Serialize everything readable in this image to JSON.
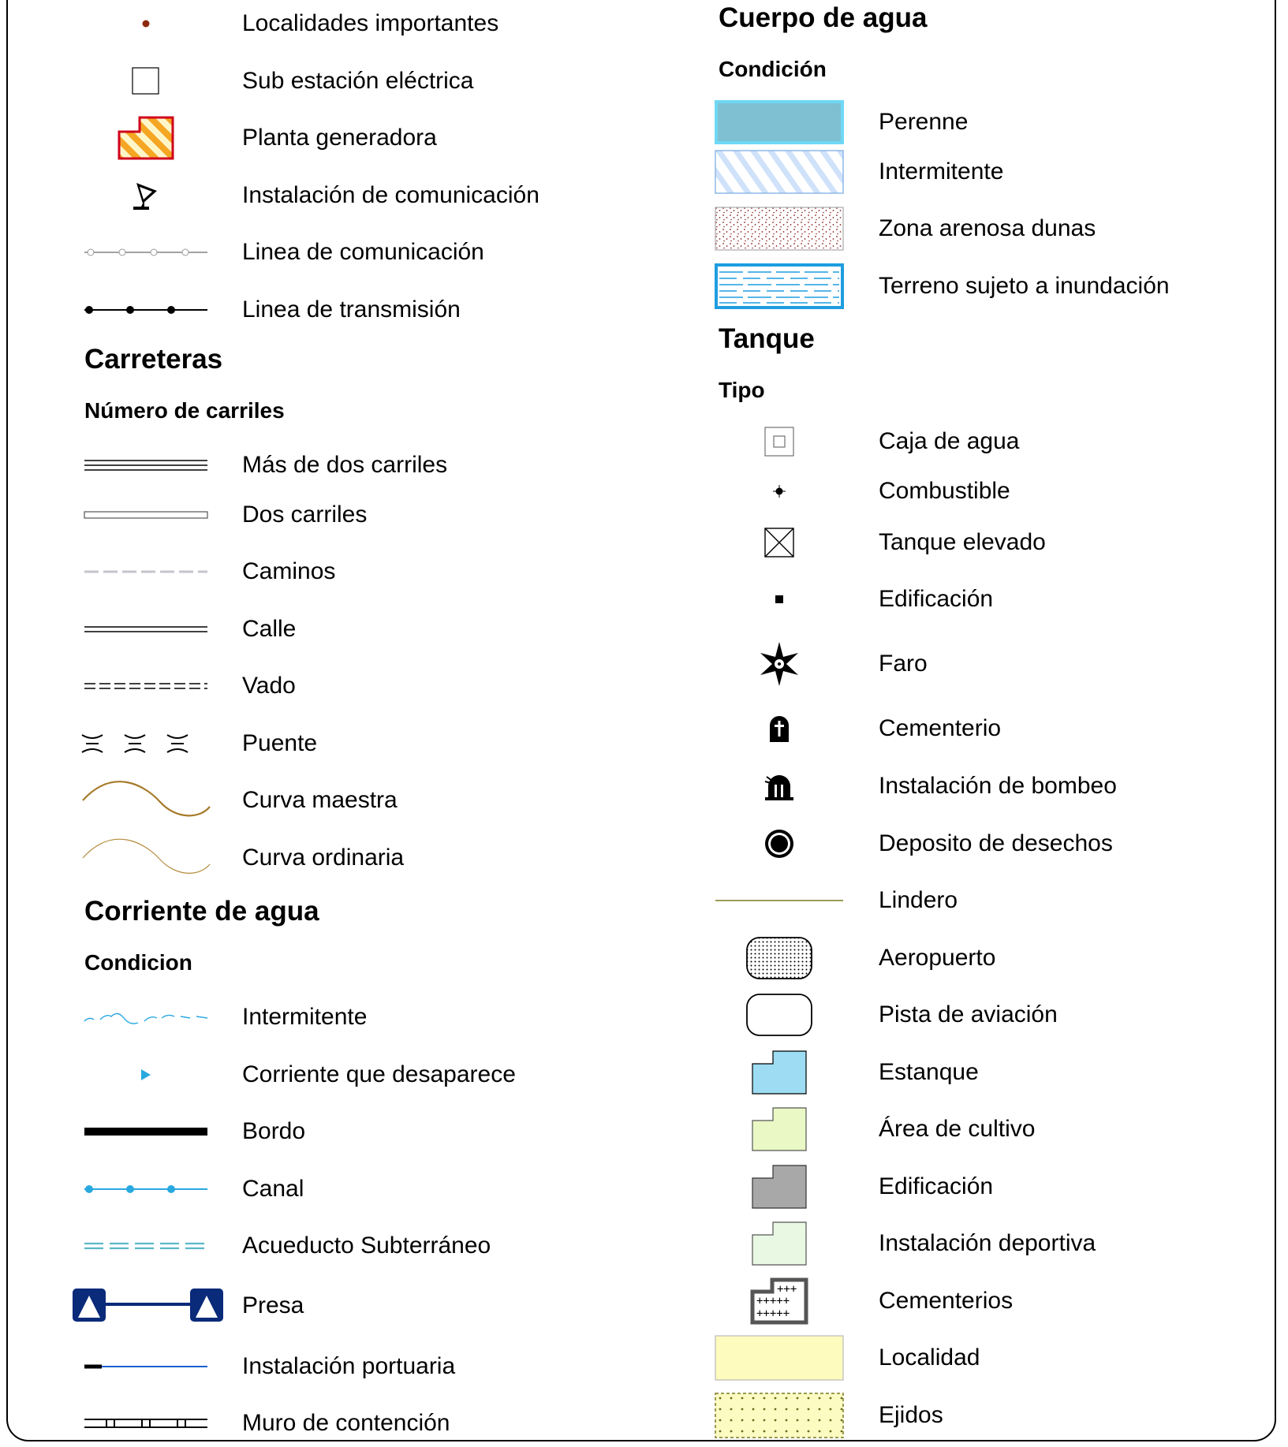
{
  "left": {
    "items_top": [
      {
        "label": "Localidades importantes",
        "icon": "localidad-dot-icon"
      },
      {
        "label": "Sub estación eléctrica",
        "icon": "substation-square-icon"
      },
      {
        "label": "Planta generadora",
        "icon": "power-plant-icon"
      },
      {
        "label": "Instalación de comunicación",
        "icon": "satellite-dish-icon"
      },
      {
        "label": "Linea de comunicación",
        "icon": "communication-line-icon"
      },
      {
        "label": "Linea de transmisión",
        "icon": "transmission-line-icon"
      }
    ],
    "carreteras": {
      "title": "Carreteras",
      "subtitle": "Número de carriles",
      "items": [
        {
          "label": "Más de dos carriles",
          "icon": "multi-lane-road-icon"
        },
        {
          "label": "Dos carriles",
          "icon": "two-lane-road-icon"
        },
        {
          "label": "Caminos",
          "icon": "path-dashed-icon"
        },
        {
          "label": "Calle",
          "icon": "street-line-icon"
        },
        {
          "label": "Vado",
          "icon": "ford-line-icon"
        },
        {
          "label": "Puente",
          "icon": "bridge-icon"
        },
        {
          "label": "Curva maestra",
          "icon": "index-contour-icon"
        },
        {
          "label": "Curva ordinaria",
          "icon": "ordinary-contour-icon"
        }
      ]
    },
    "corriente": {
      "title": "Corriente de agua",
      "subtitle": "Condicion",
      "items": [
        {
          "label": "Intermitente",
          "icon": "intermittent-stream-icon"
        },
        {
          "label": "Corriente que desaparece",
          "icon": "disappearing-stream-icon"
        },
        {
          "label": "Bordo",
          "icon": "embankment-icon"
        },
        {
          "label": "Canal",
          "icon": "canal-icon"
        },
        {
          "label": "Acueducto Subterráneo",
          "icon": "underground-aqueduct-icon"
        },
        {
          "label": "Presa",
          "icon": "dam-icon"
        },
        {
          "label": "Instalación portuaria",
          "icon": "port-facility-icon"
        },
        {
          "label": "Muro de contención",
          "icon": "retaining-wall-icon"
        }
      ]
    }
  },
  "right": {
    "cuerpo": {
      "title": "Cuerpo de agua",
      "subtitle": "Condición",
      "items": [
        {
          "label": "Perenne",
          "icon": "perennial-water-icon"
        },
        {
          "label": "Intermitente",
          "icon": "intermittent-water-icon"
        },
        {
          "label": "Zona arenosa dunas",
          "icon": "sand-dunes-icon"
        },
        {
          "label": "Terreno sujeto a inundación",
          "icon": "flood-zone-icon"
        }
      ]
    },
    "tanque": {
      "title": "Tanque",
      "subtitle": "Tipo",
      "items": [
        {
          "label": "Caja de agua",
          "icon": "water-box-icon"
        },
        {
          "label": "Combustible",
          "icon": "fuel-tank-icon"
        },
        {
          "label": "Tanque elevado",
          "icon": "elevated-tank-icon"
        },
        {
          "label": "Edificación",
          "icon": "building-point-icon"
        },
        {
          "label": "Faro",
          "icon": "lighthouse-icon"
        },
        {
          "label": "Cementerio",
          "icon": "cemetery-point-icon"
        },
        {
          "label": "Instalación de bombeo",
          "icon": "pumping-station-icon"
        },
        {
          "label": "Deposito de desechos",
          "icon": "waste-deposit-icon"
        },
        {
          "label": "Lindero",
          "icon": "boundary-line-icon"
        },
        {
          "label": "Aeropuerto",
          "icon": "airport-icon"
        },
        {
          "label": "Pista de aviación",
          "icon": "airstrip-icon"
        },
        {
          "label": "Estanque",
          "icon": "pond-area-icon"
        },
        {
          "label": "Área de cultivo",
          "icon": "crop-area-icon"
        },
        {
          "label": "Edificación",
          "icon": "building-area-icon"
        },
        {
          "label": "Instalación deportiva",
          "icon": "sports-facility-icon"
        },
        {
          "label": "Cementerios",
          "icon": "cemetery-area-icon"
        },
        {
          "label": "Localidad",
          "icon": "locality-area-icon"
        },
        {
          "label": "Ejidos",
          "icon": "ejido-area-icon"
        }
      ]
    }
  },
  "colors": {
    "dot_brown": "#8b2a0f",
    "plant_orange": "#f5a623",
    "plant_red": "#d0021b",
    "contour": "#a67a2a",
    "water_blue": "#29a8e0",
    "perennial_fill": "#7fc0d2",
    "perennial_border": "#6fd8f5",
    "dam_blue": "#0a2a7a",
    "pond": "#9ddcf2",
    "crop": "#e9f8c4",
    "building": "#a8a8a8",
    "sports": "#e8f8e2",
    "locality": "#fdfbbd",
    "ejido": "#fcfbc2",
    "boundary": "#7a7a20"
  }
}
